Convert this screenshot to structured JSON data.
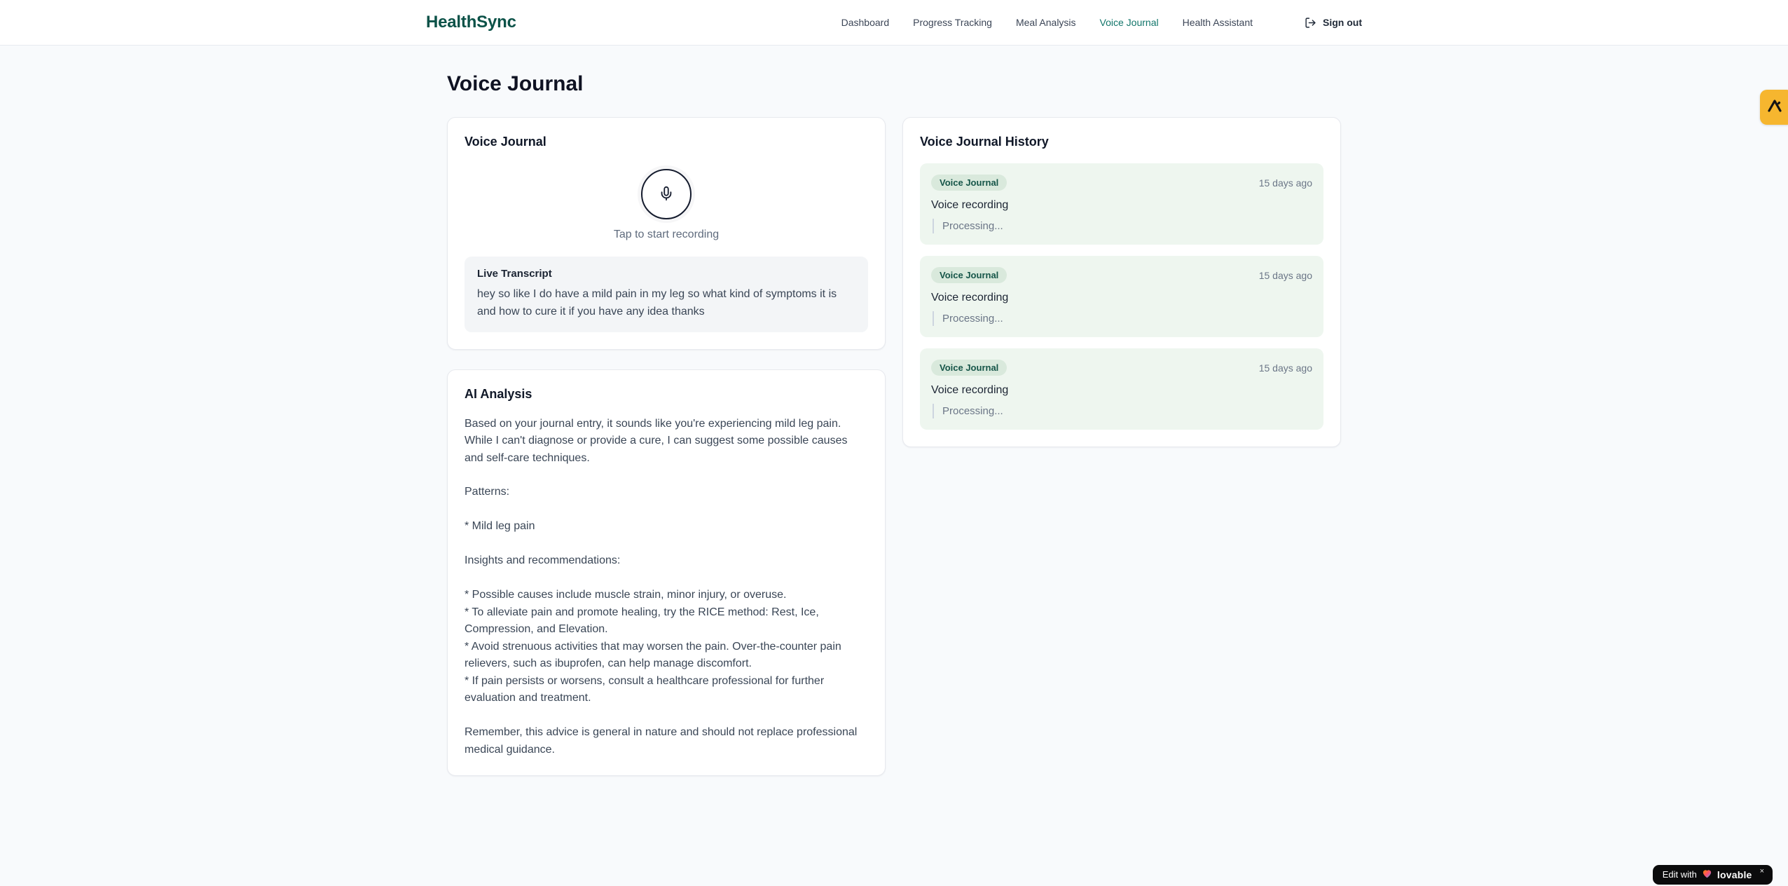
{
  "brand": "HealthSync",
  "nav": {
    "items": [
      {
        "label": "Dashboard"
      },
      {
        "label": "Progress Tracking"
      },
      {
        "label": "Meal Analysis"
      },
      {
        "label": "Voice Journal"
      },
      {
        "label": "Health Assistant"
      }
    ],
    "sign_out_label": "Sign out"
  },
  "page": {
    "title": "Voice Journal"
  },
  "recorder_card": {
    "title": "Voice Journal",
    "tap_hint": "Tap to start recording",
    "transcript_title": "Live Transcript",
    "transcript_text": "hey so like I do have a mild pain in my leg so what kind of symptoms it is and how to cure it if you have any idea thanks"
  },
  "analysis_card": {
    "title": "AI Analysis",
    "body": "Based on your journal entry, it sounds like you're experiencing mild leg pain. While I can't diagnose or provide a cure, I can suggest some possible causes and self-care techniques.\n\nPatterns:\n\n* Mild leg pain\n\nInsights and recommendations:\n\n* Possible causes include muscle strain, minor injury, or overuse.\n* To alleviate pain and promote healing, try the RICE method: Rest, Ice, Compression, and Elevation.\n* Avoid strenuous activities that may worsen the pain. Over-the-counter pain relievers, such as ibuprofen, can help manage discomfort.\n* If pain persists or worsens, consult a healthcare professional for further evaluation and treatment.\n\nRemember, this advice is general in nature and should not replace professional medical guidance."
  },
  "history_card": {
    "title": "Voice Journal History",
    "entries": [
      {
        "badge": "Voice Journal",
        "time": "15 days ago",
        "label": "Voice recording",
        "status": "Processing..."
      },
      {
        "badge": "Voice Journal",
        "time": "15 days ago",
        "label": "Voice recording",
        "status": "Processing..."
      },
      {
        "badge": "Voice Journal",
        "time": "15 days ago",
        "label": "Voice recording",
        "status": "Processing..."
      }
    ]
  },
  "widgets": {
    "edit_prefix": "Edit with",
    "edit_brand": "lovable",
    "close_label": "×"
  },
  "colors": {
    "brand_teal": "#0c5248",
    "active_nav": "#11756a",
    "entry_green": "#eef6ef",
    "badge_green": "#d9e9dc",
    "badge_text": "#155548",
    "tab_amber": "#f6b62f",
    "page_bg": "#f8fafc"
  }
}
